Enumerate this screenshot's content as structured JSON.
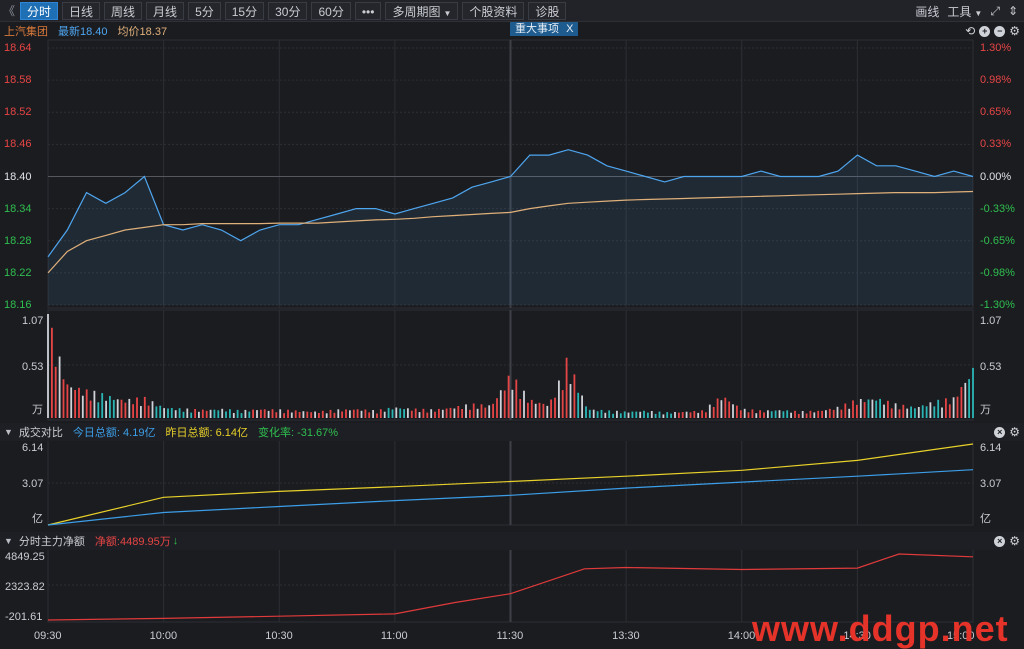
{
  "toolbar": {
    "back": "《",
    "tabs": [
      "分时",
      "日线",
      "周线",
      "月线",
      "5分",
      "15分",
      "30分",
      "60分",
      "•••",
      "多周期图",
      "个股资料",
      "诊股"
    ],
    "active": "分时",
    "right": {
      "draw": "画线",
      "tools": "工具"
    }
  },
  "quote": {
    "name": "上汽集团",
    "latest": "最新18.40",
    "avg": "均价18.37",
    "event": "重大事项",
    "event_close": "X"
  },
  "colors": {
    "up": "#e64545",
    "down": "#2fbf4f",
    "price": "#4ea6f0",
    "avg": "#e0b07a",
    "yesterday": "#e8d12a",
    "today": "#3c9ee8",
    "net": "#e03a3a",
    "grid": "#2c2e34",
    "axis": "#9aa0a8"
  },
  "price_axis": {
    "left": [
      "18.64",
      "18.58",
      "18.52",
      "18.46",
      "18.40",
      "18.34",
      "18.28",
      "18.22",
      "18.16"
    ],
    "right": [
      "1.30%",
      "0.98%",
      "0.65%",
      "0.33%",
      "0.00%",
      "-0.33%",
      "-0.65%",
      "-0.98%",
      "-1.30%"
    ]
  },
  "volume_axis": {
    "top": "1.07",
    "mid": "0.53",
    "unit": "万"
  },
  "turnover": {
    "title": "成交对比",
    "today": "今日总额: 4.19亿",
    "yesterday": "昨日总额: 6.14亿",
    "change": "变化率: -31.67%",
    "axis": [
      "6.14",
      "3.07",
      "亿"
    ]
  },
  "mainflow": {
    "title": "分时主力净额",
    "net": "净额:4489.95万",
    "arrow": "↓",
    "axis": [
      "4849.25",
      "2323.82",
      "-201.61"
    ]
  },
  "time_axis": [
    "09:30",
    "10:00",
    "10:30",
    "11:00",
    "11:30",
    "13:30",
    "14:00",
    "14:30",
    "15:00"
  ],
  "watermark": "www.ddgp.net",
  "chart_data": [
    {
      "type": "line",
      "title": "",
      "x": [
        "09:30",
        "09:35",
        "09:40",
        "09:45",
        "09:50",
        "09:55",
        "10:00",
        "10:05",
        "10:10",
        "10:15",
        "10:20",
        "10:25",
        "10:30",
        "10:35",
        "10:40",
        "10:45",
        "10:50",
        "10:55",
        "11:00",
        "11:05",
        "11:10",
        "11:15",
        "11:20",
        "11:25",
        "11:30",
        "13:05",
        "13:10",
        "13:15",
        "13:20",
        "13:25",
        "13:30",
        "13:35",
        "13:40",
        "13:45",
        "13:50",
        "13:55",
        "14:00",
        "14:05",
        "14:10",
        "14:15",
        "14:20",
        "14:25",
        "14:30",
        "14:35",
        "14:40",
        "14:45",
        "14:50",
        "14:55",
        "15:00"
      ],
      "series": [
        {
          "values": [
            18.25,
            18.3,
            18.37,
            18.35,
            18.37,
            18.4,
            18.31,
            18.3,
            18.31,
            18.3,
            18.28,
            18.3,
            18.31,
            18.31,
            18.32,
            18.33,
            18.34,
            18.34,
            18.33,
            18.34,
            18.35,
            18.36,
            18.38,
            18.39,
            18.4,
            18.44,
            18.44,
            18.45,
            18.44,
            18.42,
            18.41,
            18.4,
            18.39,
            18.4,
            18.4,
            18.4,
            18.4,
            18.41,
            18.4,
            18.4,
            18.4,
            18.41,
            18.44,
            18.42,
            18.42,
            18.41,
            18.4,
            18.41,
            18.4
          ]
        },
        {
          "values": [
            18.22,
            18.26,
            18.28,
            18.29,
            18.3,
            18.305,
            18.31,
            18.31,
            18.312,
            18.312,
            18.312,
            18.312,
            18.313,
            18.313,
            18.313,
            18.315,
            18.317,
            18.319,
            18.32,
            18.322,
            18.325,
            18.327,
            18.329,
            18.331,
            18.333,
            18.34,
            18.345,
            18.35,
            18.352,
            18.354,
            18.356,
            18.357,
            18.358,
            18.359,
            18.36,
            18.361,
            18.362,
            18.363,
            18.364,
            18.365,
            18.366,
            18.367,
            18.368,
            18.369,
            18.37,
            18.37,
            18.37,
            18.371,
            18.372
          ]
        }
      ],
      "ylim": [
        18.16,
        18.64
      ]
    },
    {
      "type": "bar",
      "title": "",
      "x": [
        "09:30",
        "09:35",
        "09:40",
        "09:45",
        "09:50",
        "09:55",
        "10:00",
        "10:05",
        "10:10",
        "10:15",
        "10:20",
        "10:25",
        "10:30",
        "10:35",
        "10:40",
        "10:45",
        "10:50",
        "10:55",
        "11:00",
        "11:05",
        "11:10",
        "11:15",
        "11:20",
        "11:25",
        "11:30",
        "13:05",
        "13:10",
        "13:15",
        "13:20",
        "13:25",
        "13:30",
        "13:35",
        "13:40",
        "13:45",
        "13:50",
        "13:55",
        "14:00",
        "14:05",
        "14:10",
        "14:15",
        "14:20",
        "14:25",
        "14:30",
        "14:35",
        "14:40",
        "14:45",
        "14:50",
        "14:55",
        "15:00"
      ],
      "values": [
        1.07,
        0.38,
        0.3,
        0.25,
        0.2,
        0.22,
        0.12,
        0.1,
        0.09,
        0.1,
        0.08,
        0.1,
        0.09,
        0.08,
        0.07,
        0.09,
        0.1,
        0.08,
        0.12,
        0.1,
        0.09,
        0.12,
        0.15,
        0.14,
        0.48,
        0.2,
        0.15,
        0.62,
        0.1,
        0.08,
        0.07,
        0.08,
        0.06,
        0.07,
        0.08,
        0.25,
        0.1,
        0.08,
        0.09,
        0.07,
        0.08,
        0.12,
        0.2,
        0.22,
        0.15,
        0.12,
        0.18,
        0.22,
        0.55
      ],
      "ylim": [
        0,
        1.07
      ]
    },
    {
      "type": "line",
      "title": "",
      "x": [
        "09:30",
        "10:00",
        "10:30",
        "11:00",
        "11:30",
        "13:30",
        "14:00",
        "14:30",
        "15:00"
      ],
      "series": [
        {
          "name": "昨日总额",
          "values": [
            0,
            2.1,
            2.55,
            2.9,
            3.3,
            3.7,
            4.15,
            4.9,
            6.14
          ]
        },
        {
          "name": "今日总额",
          "values": [
            0,
            0.95,
            1.4,
            1.85,
            2.25,
            2.8,
            3.25,
            3.7,
            4.19
          ]
        }
      ],
      "ylim": [
        0,
        6.14
      ]
    },
    {
      "type": "line",
      "title": "",
      "x": [
        "09:30",
        "10:00",
        "10:30",
        "11:00",
        "11:15",
        "11:30",
        "13:10",
        "13:30",
        "14:00",
        "14:30",
        "14:45",
        "15:00"
      ],
      "series": [
        {
          "values": [
            -201.61,
            -80,
            80,
            250,
            1100,
            1750,
            3600,
            3700,
            3550,
            3650,
            4700,
            4489.95
          ]
        }
      ],
      "ylim": [
        -201.61,
        4849.25
      ]
    }
  ]
}
